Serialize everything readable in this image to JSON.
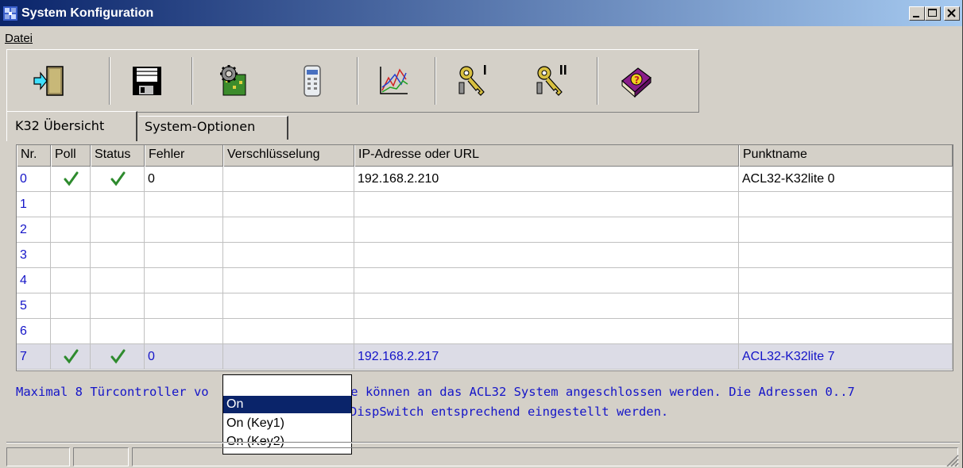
{
  "window": {
    "title": "System Konfiguration",
    "controls": [
      "minimize",
      "maximize",
      "close"
    ]
  },
  "menu": {
    "items": [
      {
        "label": "Datei"
      }
    ]
  },
  "toolbar": {
    "buttons": [
      {
        "name": "exit",
        "icon": "exit-door-icon"
      },
      {
        "name": "save",
        "icon": "floppy-disk-icon"
      },
      {
        "name": "settings",
        "icon": "gear-board-icon"
      },
      {
        "name": "device",
        "icon": "controller-device-icon"
      },
      {
        "name": "chart",
        "icon": "line-chart-icon"
      },
      {
        "name": "key1",
        "icon": "key-one-icon"
      },
      {
        "name": "key2",
        "icon": "key-two-icon"
      },
      {
        "name": "help",
        "icon": "help-book-icon"
      }
    ]
  },
  "tabs": [
    {
      "label": "K32 Übersicht",
      "active": true
    },
    {
      "label": "System-Optionen",
      "active": false
    }
  ],
  "grid": {
    "columns": [
      "Nr.",
      "Poll",
      "Status",
      "Fehler",
      "Verschlüsselung",
      "IP-Adresse oder URL",
      "Punktname"
    ],
    "rows": [
      {
        "nr": "0",
        "poll": true,
        "status": true,
        "fehler": "0",
        "verschluesselung": "",
        "ip": "192.168.2.210",
        "punktname": "ACL32-K32lite 0"
      },
      {
        "nr": "1",
        "poll": false,
        "status": false,
        "fehler": "",
        "verschluesselung": "",
        "ip": "",
        "punktname": ""
      },
      {
        "nr": "2",
        "poll": false,
        "status": false,
        "fehler": "",
        "verschluesselung": "",
        "ip": "",
        "punktname": ""
      },
      {
        "nr": "3",
        "poll": false,
        "status": false,
        "fehler": "",
        "verschluesselung": "",
        "ip": "",
        "punktname": ""
      },
      {
        "nr": "4",
        "poll": false,
        "status": false,
        "fehler": "",
        "verschluesselung": "",
        "ip": "",
        "punktname": ""
      },
      {
        "nr": "5",
        "poll": false,
        "status": false,
        "fehler": "",
        "verschluesselung": "",
        "ip": "",
        "punktname": ""
      },
      {
        "nr": "6",
        "poll": false,
        "status": false,
        "fehler": "",
        "verschluesselung": "",
        "ip": "",
        "punktname": ""
      },
      {
        "nr": "7",
        "poll": true,
        "status": true,
        "fehler": "0",
        "verschluesselung": "",
        "ip": "192.168.2.217",
        "punktname": "ACL32-K32lite 7",
        "selected": true
      }
    ]
  },
  "info": {
    "line1_left": "Maximal 8 Türcontroller vo",
    "line1_right": "ite können an das ACL32 System angeschlossen werden. Die Adressen 0..7",
    "line2_right": "DispSwitch entsprechend eingestellt werden."
  },
  "dropdown": {
    "options": [
      "",
      "On",
      "On (Key1)",
      "On (Key2)"
    ],
    "highlighted_index": 1
  },
  "colors": {
    "title_gradient_start": "#0a246a",
    "title_gradient_end": "#a6caf0",
    "window_bg": "#d4d0c8",
    "accent_text": "#1414c8",
    "check_green": "#2e8b2e",
    "selection": "#0a246a"
  }
}
